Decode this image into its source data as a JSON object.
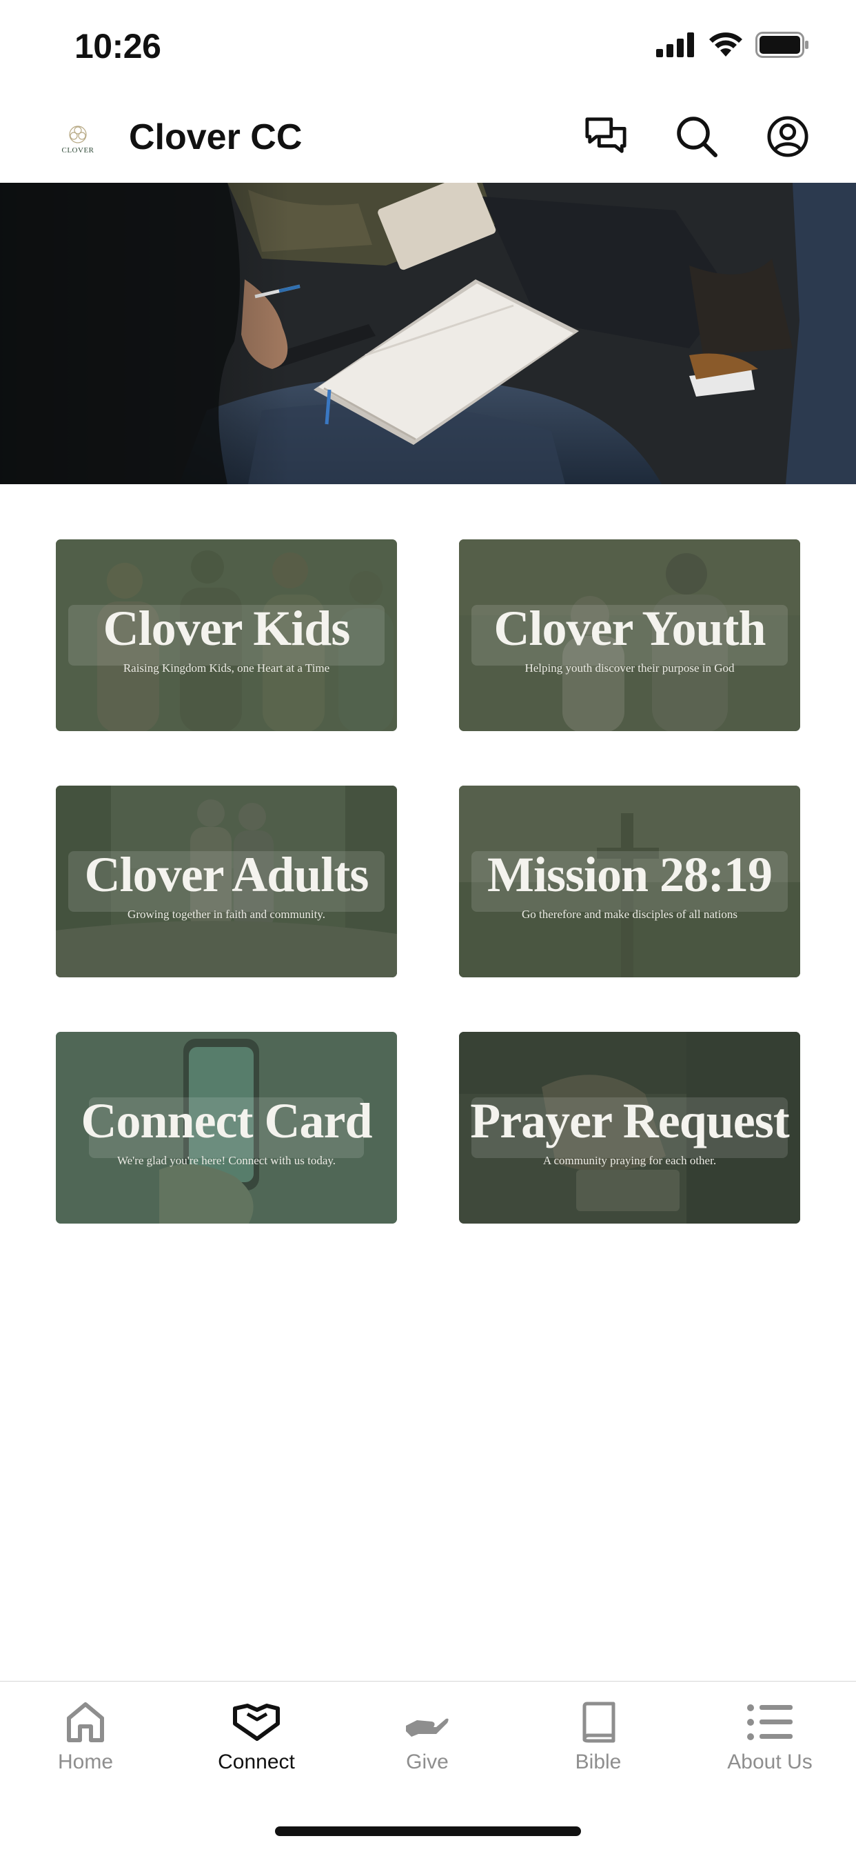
{
  "status_bar": {
    "time": "10:26"
  },
  "header": {
    "logo_text": "CLOVER",
    "title": "Clover CC"
  },
  "cards": [
    {
      "title": "Clover Kids",
      "subtitle": "Raising Kingdom Kids, one Heart at a Time"
    },
    {
      "title": "Clover Youth",
      "subtitle": "Helping youth discover their purpose in God"
    },
    {
      "title": "Clover Adults",
      "subtitle": "Growing together in faith and community."
    },
    {
      "title": "Mission 28:19",
      "subtitle": "Go therefore and make disciples of all nations"
    },
    {
      "title": "Connect Card",
      "subtitle": "We're glad you're here! Connect with us today."
    },
    {
      "title": "Prayer Request",
      "subtitle": "A community praying for each other."
    }
  ],
  "tabs": [
    {
      "label": "Home",
      "icon": "home-icon",
      "active": false
    },
    {
      "label": "Connect",
      "icon": "handshake-icon",
      "active": true
    },
    {
      "label": "Give",
      "icon": "give-hand-icon",
      "active": false
    },
    {
      "label": "Bible",
      "icon": "book-icon",
      "active": false
    },
    {
      "label": "About Us",
      "icon": "list-icon",
      "active": false
    }
  ],
  "colors": {
    "card_overlay": "#4b5a45",
    "tab_active": "#111111",
    "tab_inactive": "#8e8e8e"
  }
}
